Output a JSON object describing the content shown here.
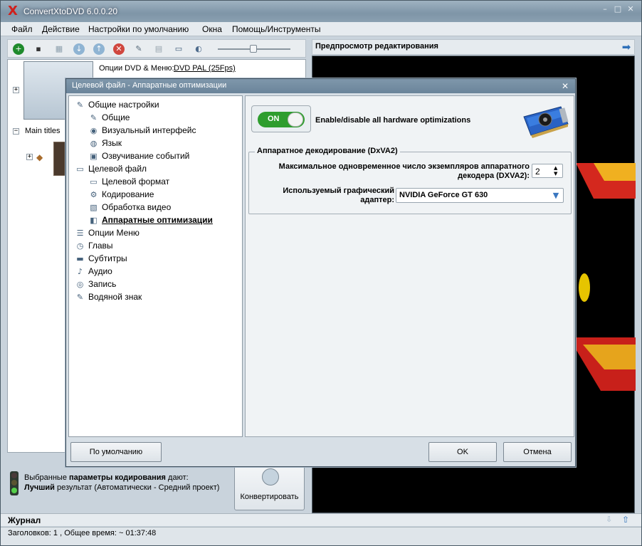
{
  "app": {
    "title": "ConvertXtoDVD 6.0.0.20",
    "logo_glyph": "X",
    "window_buttons": [
      "–",
      "□",
      "✕"
    ]
  },
  "menu": [
    "Файл",
    "Действие",
    "Настройки по умолчанию",
    "Окна",
    "Помощь/Инструменты"
  ],
  "toolbar": {
    "icons": [
      "add-icon",
      "save-icon",
      "chapters-icon",
      "down-icon",
      "up-icon",
      "delete-icon",
      "tools-icon",
      "grid-icon",
      "monitor-icon",
      "burn-icon"
    ],
    "glyphs": [
      "+",
      "▪",
      "▦",
      "↓",
      "↑",
      "✕",
      "✎",
      "▤",
      "▭",
      "◐"
    ]
  },
  "left_panel": {
    "dvd_options_label": "Опции DVD & Меню:",
    "dvd_options_value": "DVD PAL (25Fps)",
    "main_titles_label": "Main titles",
    "expander_glyph": "+"
  },
  "status": {
    "line1_pre": "Выбранные",
    "line1_bold": "параметры кодирования",
    "line1_post": "дают:",
    "line2_bold": "Лучший",
    "line2_post": "результат (Автоматически - Средний проект)"
  },
  "convert_button": "Конвертировать",
  "preview": {
    "title": "Предпросмотр редактирования",
    "arrow_glyph": "➡"
  },
  "log": {
    "label": "Журнал"
  },
  "bottom_status": "Заголовков: 1 , Общее время: ~ 01:37:48",
  "dialog": {
    "title": "Целевой файл - Аппаратные оптимизации",
    "close_glyph": "✕",
    "tree": [
      {
        "label": "Общие настройки",
        "icon": "wrench-icon",
        "glyph": "✎",
        "level": 0
      },
      {
        "label": "Общие",
        "icon": "wrench-icon",
        "glyph": "✎",
        "level": 1
      },
      {
        "label": "Визуальный интерфейс",
        "icon": "palette-icon",
        "glyph": "◉",
        "level": 1
      },
      {
        "label": "Язык",
        "icon": "globe-icon",
        "glyph": "◍",
        "level": 1
      },
      {
        "label": "Озвучивание событий",
        "icon": "sound-events-icon",
        "glyph": "▣",
        "level": 1
      },
      {
        "label": "Целевой файл",
        "icon": "monitor-icon",
        "glyph": "▭",
        "level": 0
      },
      {
        "label": "Целевой формат",
        "icon": "monitor-icon",
        "glyph": "▭",
        "level": 1
      },
      {
        "label": "Кодирование",
        "icon": "gear-icon",
        "glyph": "⚙",
        "level": 1
      },
      {
        "label": "Обработка видео",
        "icon": "video-processing-icon",
        "glyph": "▧",
        "level": 1
      },
      {
        "label": "Аппаратные оптимизации",
        "icon": "hardware-icon",
        "glyph": "◧",
        "level": 1,
        "selected": true
      },
      {
        "label": "Опции Меню",
        "icon": "menu-icon",
        "glyph": "☰",
        "level": 0
      },
      {
        "label": "Главы",
        "icon": "clock-icon",
        "glyph": "◷",
        "level": 0
      },
      {
        "label": "Субтитры",
        "icon": "subtitles-icon",
        "glyph": "▬",
        "level": 0
      },
      {
        "label": "Аудио",
        "icon": "music-note-icon",
        "glyph": "♪",
        "level": 0
      },
      {
        "label": "Запись",
        "icon": "disc-icon",
        "glyph": "◎",
        "level": 0
      },
      {
        "label": "Водяной знак",
        "icon": "wrench-icon",
        "glyph": "✎",
        "level": 0
      }
    ],
    "toggle_label": "ON",
    "toggle_on": true,
    "hw_opt_label": "Enable/disable all hardware optimizations",
    "group_title": "Аппаратное декодирование (DxVA2)",
    "max_instances_label": "Максимальное одновременное число экземпляров аппаратного декодера (DXVA2):",
    "max_instances_value": "2",
    "spin_up_glyph": "▲",
    "spin_down_glyph": "▼",
    "adapter_label": "Используемый графический адаптер:",
    "adapter_value": "NVIDIA GeForce GT 630",
    "adapter_arrow_glyph": "▼",
    "buttons": {
      "default": "По умолчанию",
      "ok": "OK",
      "cancel": "Отмена"
    }
  },
  "colors": {
    "toggle_on": "#2e9d2e",
    "accent": "#d0201c",
    "preview_bg": "#000000"
  }
}
